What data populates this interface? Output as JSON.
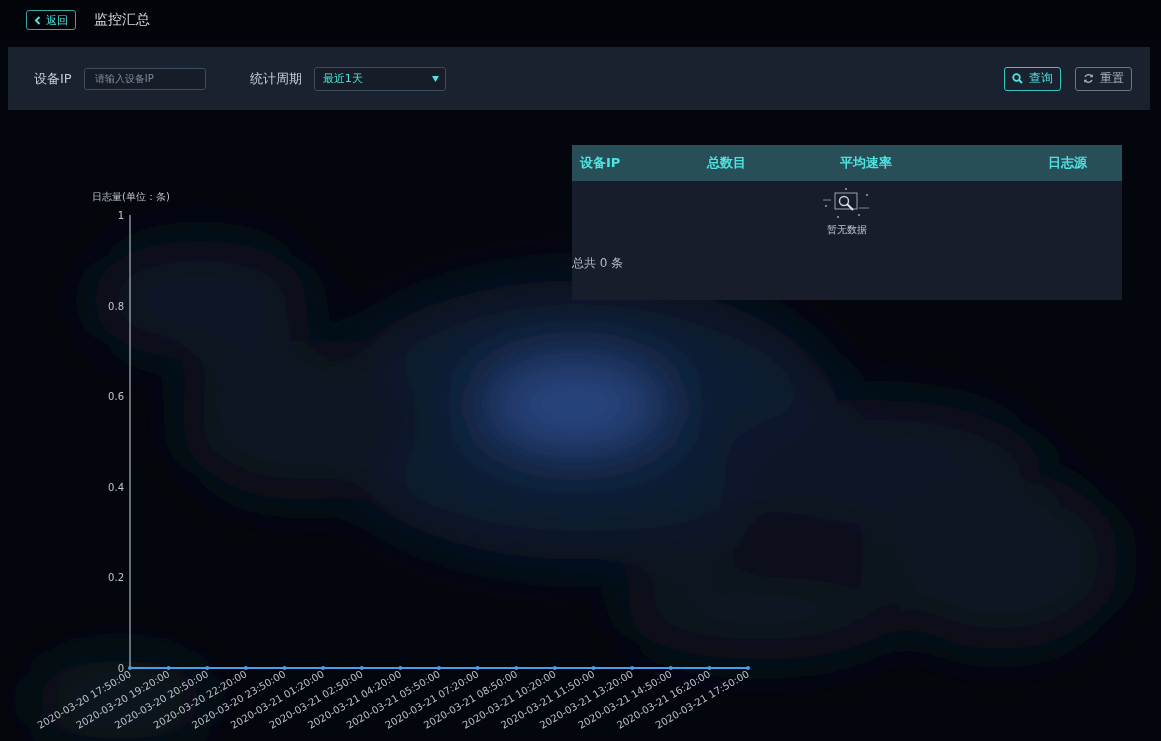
{
  "header": {
    "back_button": "返回",
    "title": "监控汇总"
  },
  "filters": {
    "device_ip": {
      "label": "设备IP",
      "placeholder": "请输入设备IP"
    },
    "period": {
      "label": "统计周期",
      "value": "最近1天"
    }
  },
  "buttons": [
    {
      "kind": "search",
      "label": "查询"
    },
    {
      "kind": "reset",
      "label": "重置"
    }
  ],
  "table": {
    "columns": [
      "设备IP",
      "总数目",
      "平均速率",
      "日志源"
    ],
    "empty_text": "暂无数据",
    "total": "总共 0 条"
  },
  "chart": {
    "chart_data": {
      "type": "line",
      "ylabel": "日志量(单位：条)",
      "categories": [
        "2020-03-20 17:50:00",
        "2020-03-20 19:20:00",
        "2020-03-20 20:50:00",
        "2020-03-20 22:20:00",
        "2020-03-20 23:50:00",
        "2020-03-21 01:20:00",
        "2020-03-21 02:50:00",
        "2020-03-21 04:20:00",
        "2020-03-21 05:50:00",
        "2020-03-21 07:20:00",
        "2020-03-21 08:50:00",
        "2020-03-21 10:20:00",
        "2020-03-21 11:50:00",
        "2020-03-21 13:20:00",
        "2020-03-21 14:50:00",
        "2020-03-21 16:20:00",
        "2020-03-21 17:50:00"
      ],
      "ylim": [
        0,
        1
      ],
      "yticks": [
        0,
        0.2,
        0.4,
        0.6,
        0.8,
        1
      ],
      "series": [
        {
          "color": "#4a9ee8",
          "values": [
            0,
            0,
            0,
            0,
            0,
            0,
            0,
            0,
            0,
            0,
            0,
            0,
            0,
            0,
            0,
            0,
            0
          ]
        }
      ]
    }
  }
}
